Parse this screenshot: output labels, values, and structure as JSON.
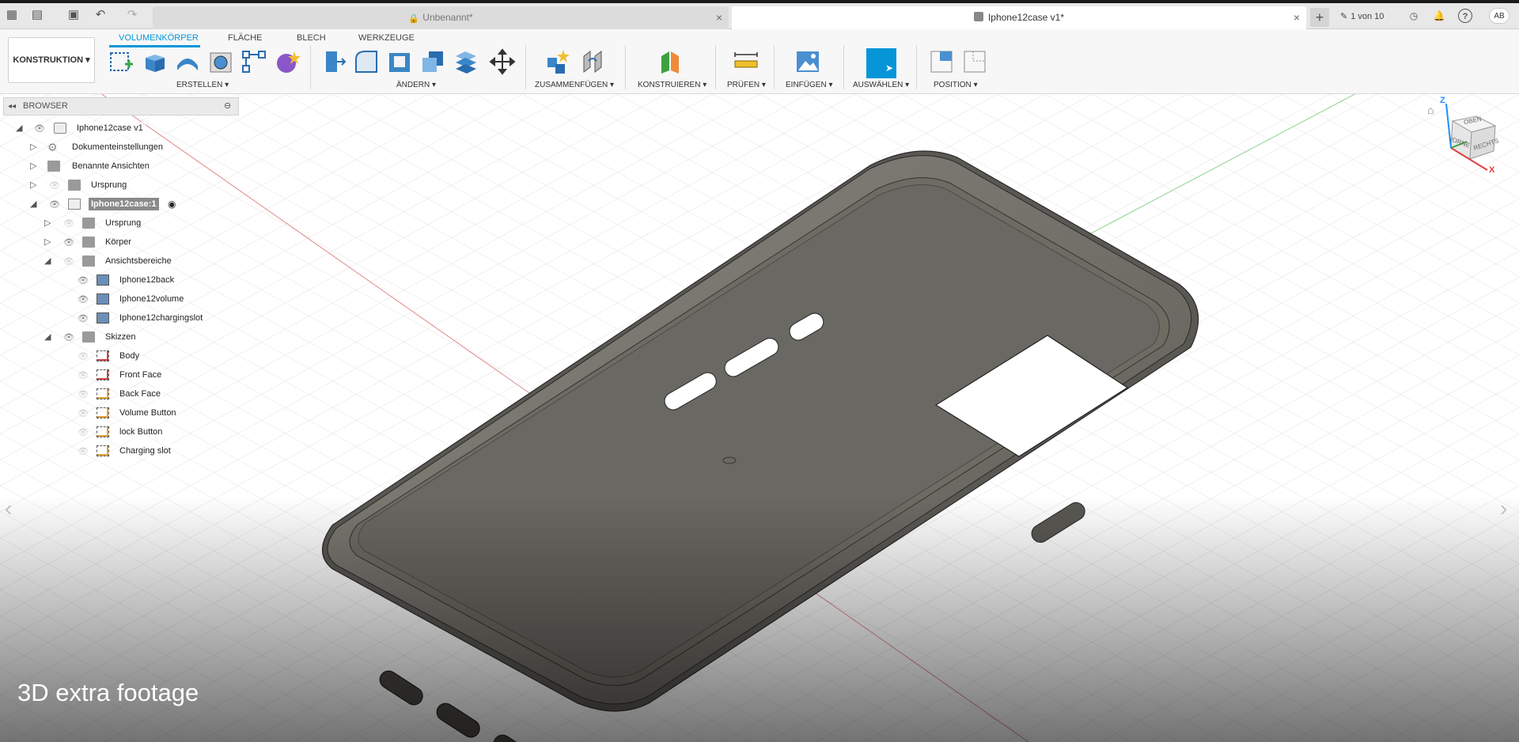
{
  "titlebar": {
    "tabs": [
      {
        "label": "Unbenannt*",
        "active": false
      },
      {
        "label": "Iphone12case v1*",
        "active": true
      }
    ],
    "job_status": "1 von 10",
    "user_initials": "AB",
    "icons": [
      "app-grid-icon",
      "file-icon",
      "save-icon",
      "undo-icon",
      "redo-icon",
      "new-tab-icon",
      "job-status-icon",
      "clock-icon",
      "bell-icon",
      "help-icon"
    ]
  },
  "toolbar": {
    "workspace": "KONSTRUKTION",
    "workspace_tabs": [
      "VOLUMENKÖRPER",
      "FLÄCHE",
      "BLECH",
      "WERKZEUGE"
    ],
    "groups": [
      "ERSTELLEN",
      "ÄNDERN",
      "ZUSAMMENFÜGEN",
      "KONSTRUIEREN",
      "PRÜFEN",
      "EINFÜGEN",
      "AUSWÄHLEN",
      "POSITION"
    ],
    "accent": "#0696d7"
  },
  "browser": {
    "title": "BROWSER",
    "items": [
      {
        "label": "Iphone12case v1"
      },
      {
        "label": "Dokumenteinstellungen"
      },
      {
        "label": "Benannte Ansichten"
      },
      {
        "label": "Ursprung"
      },
      {
        "label": "Iphone12case:1"
      },
      {
        "label": "Ursprung"
      },
      {
        "label": "Körper"
      },
      {
        "label": "Ansichtsbereiche"
      },
      {
        "label": "Iphone12back"
      },
      {
        "label": "Iphone12volume"
      },
      {
        "label": "Iphone12chargingslot"
      },
      {
        "label": "Skizzen"
      },
      {
        "label": "Body"
      },
      {
        "label": "Front Face"
      },
      {
        "label": "Back Face"
      },
      {
        "label": "Volume Button"
      },
      {
        "label": "lock Button"
      },
      {
        "label": "Charging slot"
      }
    ]
  },
  "viewcube": {
    "top": "OBEN",
    "front": "VORNE",
    "right": "RECHTS",
    "axis_x": "X",
    "axis_z": "Z"
  },
  "caption": "3D extra footage"
}
